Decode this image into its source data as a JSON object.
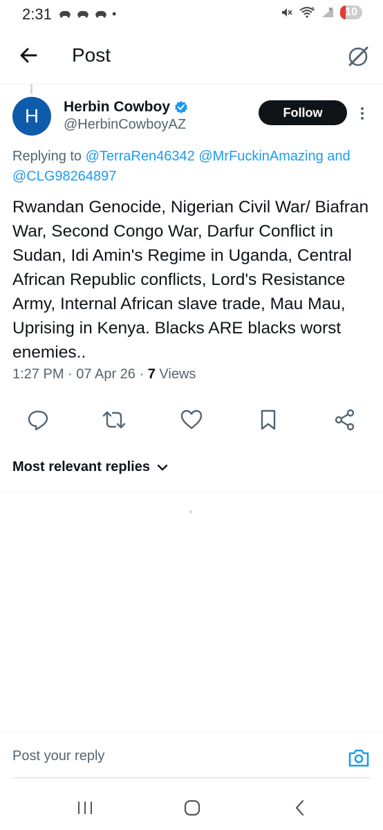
{
  "status_bar": {
    "time": "2:31",
    "dot": "•",
    "battery": "10",
    "network": "5"
  },
  "header": {
    "title": "Post",
    "back_icon": "arrow-left-icon",
    "grok_icon": "slash-circle-icon"
  },
  "tweet": {
    "avatar_letter": "H",
    "author_name": "Herbin Cowboy",
    "handle": "@HerbinCowboyAZ",
    "follow_label": "Follow",
    "replying_prefix": "Replying to",
    "mentions": [
      "@TerraRen46342",
      "@MrFuckinAmazing",
      "@CLG98264897"
    ],
    "mention_joiner": "and",
    "text": "Rwandan Genocide, Nigerian Civil War/ Biafran War, Second Congo War, Darfur Conflict in Sudan, Idi Amin's Regime in Uganda, Central African Republic conflicts, Lord's Resistance Army, Internal African slave trade, Mau Mau, Uprising in Kenya. Blacks ARE blacks worst enemies..",
    "time": "1:27 PM",
    "date": "07 Apr 26",
    "views_count": "7",
    "views_label": "Views",
    "separator": "·"
  },
  "actions": [
    "reply-icon",
    "retweet-icon",
    "like-icon",
    "bookmark-icon",
    "share-icon"
  ],
  "replies": {
    "sort_label": "Most relevant replies"
  },
  "reply_bar": {
    "placeholder": "Post your reply"
  },
  "colors": {
    "accent": "#1d9bf0",
    "text": "#0f1419",
    "muted": "#536471",
    "avatar_bg": "#0e5bab"
  }
}
